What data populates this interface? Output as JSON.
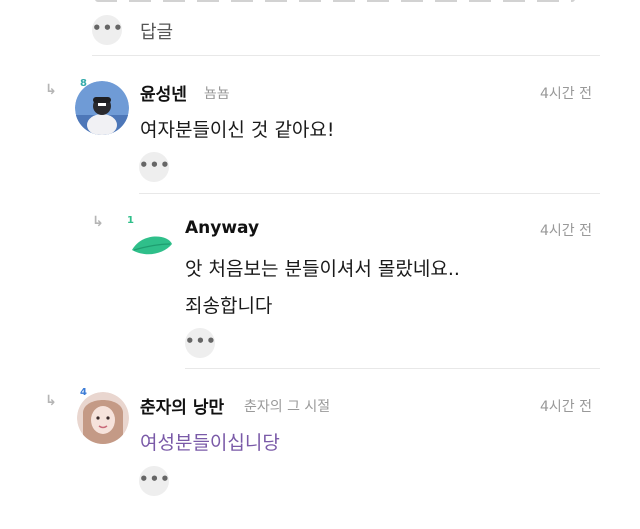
{
  "prev_comment": {
    "reply_label": "답글",
    "more_label": "•••"
  },
  "comments": [
    {
      "name": "윤성넨",
      "subtitle": "뇸뇸",
      "time": "4시간 전",
      "text": "여자분들이신 것 같아요!",
      "level_badge": "8",
      "more_label": "•••"
    },
    {
      "name": "Anyway",
      "subtitle": "",
      "time": "4시간 전",
      "text_lines": [
        "앗 처음보는 분들이셔서 몰랐네요..",
        "죄송합니다"
      ],
      "level_badge": "1",
      "more_label": "•••"
    },
    {
      "name": "춘자의 낭만",
      "subtitle": "춘자의 그 시절",
      "time": "4시간 전",
      "text": "여성분들이십니당",
      "level_badge": "4",
      "more_label": "•••"
    }
  ],
  "colors": {
    "accent_purple": "#7a5aa8",
    "leaf_green": "#2fbf8a"
  }
}
